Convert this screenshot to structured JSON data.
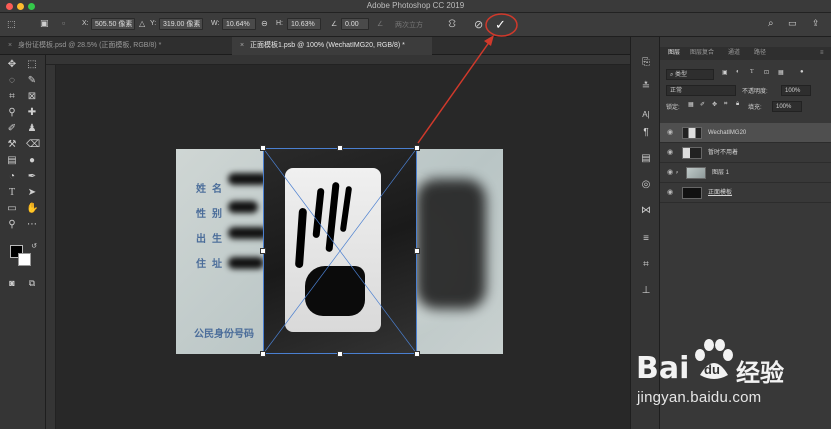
{
  "window": {
    "title": "Adobe Photoshop CC 2019",
    "traffic_lights": [
      "#fc5c56",
      "#fdbb2e",
      "#34c84a"
    ]
  },
  "options_bar": {
    "x_label": "X:",
    "x_value": "505.50 像素",
    "y_label": "Y:",
    "y_value": "319.00 像素",
    "w_label": "W:",
    "w_value": "10.64%",
    "h_label": "H:",
    "h_value": "10.63%",
    "angle_label": "∠",
    "angle_value": "0.00",
    "interp_label": "两次立方",
    "warp_icon": "warp-icon",
    "cancel_icon": "cancel-transform-icon",
    "commit_icon": "commit-checkmark-icon"
  },
  "tabs": [
    {
      "label": "身份证模板.psd @ 28.5% (正面模板, RGB/8) *"
    },
    {
      "label": "正面模板1.psb @ 100% (WechatIMG20, RGB/8) *"
    }
  ],
  "id_card": {
    "labels": [
      "姓名",
      "性别",
      "出生",
      "住址"
    ],
    "footer": "公民身份号码"
  },
  "layers_panel": {
    "tabs": [
      "图层",
      "图层复合",
      "通道",
      "路径"
    ],
    "kind_filter": "类型",
    "blend_mode": "正常",
    "opacity_label": "不透明度:",
    "opacity_value": "100%",
    "lock_label": "锁定:",
    "fill_label": "填充:",
    "fill_value": "100%",
    "layers": [
      {
        "name": "WechatIMG20",
        "selected": true
      },
      {
        "name": "暂时不用着",
        "selected": false
      },
      {
        "name": "图层 1",
        "selected": false
      },
      {
        "name": "正面模板",
        "selected": false
      }
    ]
  },
  "watermark": {
    "brand": "Bai",
    "brand2": "du",
    "brand3": "经验",
    "url": "jingyan.baidu.com"
  },
  "colors": {
    "annotation_red": "#d0392b",
    "selection_blue": "#4a7fd0"
  }
}
